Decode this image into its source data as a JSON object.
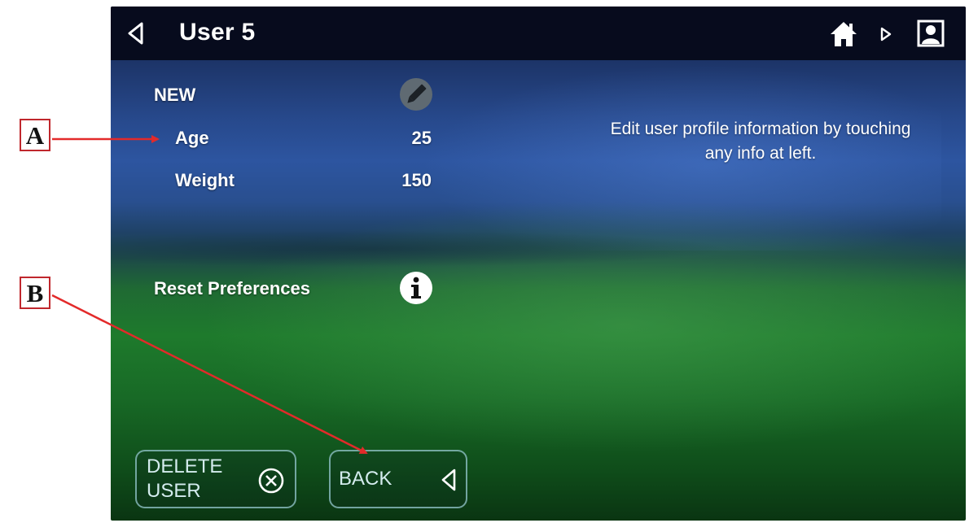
{
  "window": {
    "title": "User 5"
  },
  "profile": {
    "name_label": "NEW",
    "age": {
      "label": "Age",
      "value": "25"
    },
    "weight": {
      "label": "Weight",
      "value": "150"
    }
  },
  "reset": {
    "label": "Reset Preferences"
  },
  "help_text": "Edit user profile information by touching any info at left.",
  "buttons": {
    "delete_label": "DELETE\nUSER",
    "back_label": "BACK"
  },
  "callouts": {
    "a": "A",
    "b": "B"
  },
  "icons": {
    "title_back": "back-triangle-icon",
    "home": "home-icon",
    "play": "play-icon",
    "profile": "profile-icon",
    "edit": "pencil-icon",
    "info": "info-icon",
    "delete": "circle-x-icon",
    "back": "back-triangle-icon"
  },
  "colors": {
    "titlebar": "#070b1d",
    "callout_red": "#c0272d",
    "button_border": "#96c8cd",
    "text": "#ffffff"
  }
}
